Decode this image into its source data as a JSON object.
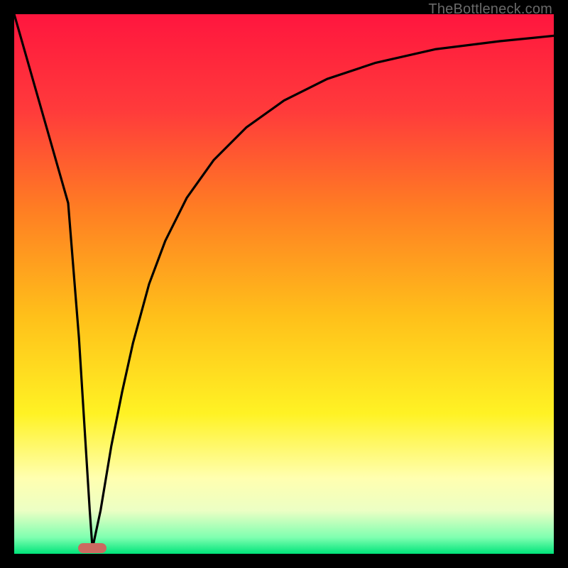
{
  "attribution": "TheBottleneck.com",
  "colors": {
    "frame": "#000000",
    "marker": "#cb6960",
    "gradient_stops": [
      {
        "offset": 0.0,
        "color": "#ff163e"
      },
      {
        "offset": 0.18,
        "color": "#ff3b3b"
      },
      {
        "offset": 0.36,
        "color": "#ff7d23"
      },
      {
        "offset": 0.56,
        "color": "#ffc01a"
      },
      {
        "offset": 0.74,
        "color": "#fff224"
      },
      {
        "offset": 0.86,
        "color": "#ffffb0"
      },
      {
        "offset": 0.92,
        "color": "#ecffc4"
      },
      {
        "offset": 0.97,
        "color": "#7effb0"
      },
      {
        "offset": 1.0,
        "color": "#00e47a"
      }
    ]
  },
  "chart_data": {
    "type": "line",
    "title": "",
    "xlabel": "",
    "ylabel": "",
    "xlim": [
      0,
      100
    ],
    "ylim": [
      0,
      100
    ],
    "grid": false,
    "legend": false,
    "marker": {
      "x": 14.5,
      "y": 1,
      "shape": "pill"
    },
    "series": [
      {
        "name": "left-branch",
        "x": [
          0,
          2,
          4,
          6,
          8,
          10,
          12,
          14,
          14.5
        ],
        "values": [
          100,
          93,
          86,
          79,
          72,
          65,
          40,
          8,
          1
        ]
      },
      {
        "name": "right-branch",
        "x": [
          14.5,
          16,
          18,
          20,
          22,
          25,
          28,
          32,
          37,
          43,
          50,
          58,
          67,
          78,
          90,
          100
        ],
        "values": [
          1,
          8,
          20,
          30,
          39,
          50,
          58,
          66,
          73,
          79,
          84,
          88,
          91,
          93.5,
          95,
          96
        ]
      }
    ]
  }
}
